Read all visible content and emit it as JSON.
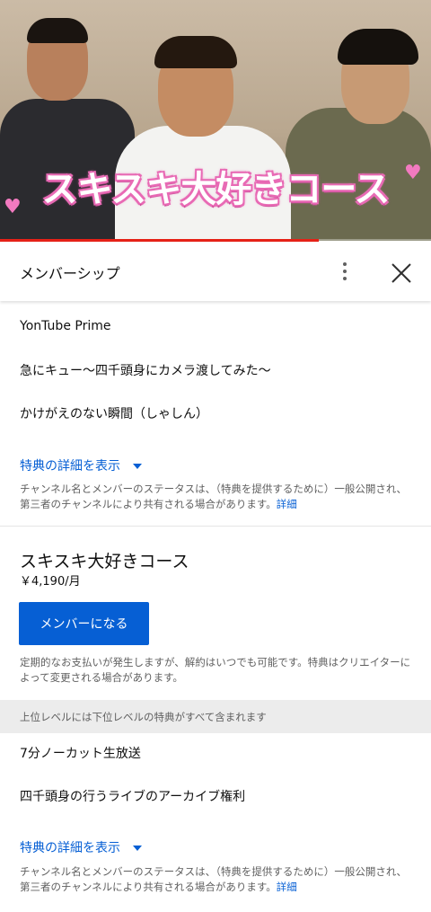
{
  "video": {
    "overlay_text": "スキスキ大好きコース",
    "heart_glyph": "♥",
    "progress": 0.74,
    "progress_color": "#e62117"
  },
  "header": {
    "title": "メンバーシップ",
    "more_icon": "more-vert-icon",
    "close_icon": "close-icon"
  },
  "lower_tier": {
    "perks": [
      "YonTube Prime",
      "急にキュー〜四千頭身にカメラ渡してみた〜",
      "かけがえのない瞬間（しゃしん）"
    ],
    "details_link": "特典の詳細を表示",
    "notice": "チャンネル名とメンバーのステータスは、（特典を提供するために）一般公開され、第三者のチャンネルにより共有される場合があります。",
    "notice_link": "詳細"
  },
  "tier": {
    "name": "スキスキ大好きコース",
    "price": "￥4,190/月",
    "join_button": "メンバーになる",
    "billing_note": "定期的なお支払いが発生しますが、解約はいつでも可能です。特典はクリエイターによって変更される場合があります。",
    "includes_banner": "上位レベルには下位レベルの特典がすべて含まれます",
    "perks": [
      "7分ノーカット生放送",
      "四千頭身の行うライブのアーカイブ権利"
    ],
    "details_link": "特典の詳細を表示",
    "notice": "チャンネル名とメンバーのステータスは、（特典を提供するために）一般公開され、第三者のチャンネルにより共有される場合があります。",
    "notice_link": "詳細"
  },
  "colors": {
    "accent": "#065fd4",
    "overlay_pink": "#e86bb5"
  }
}
